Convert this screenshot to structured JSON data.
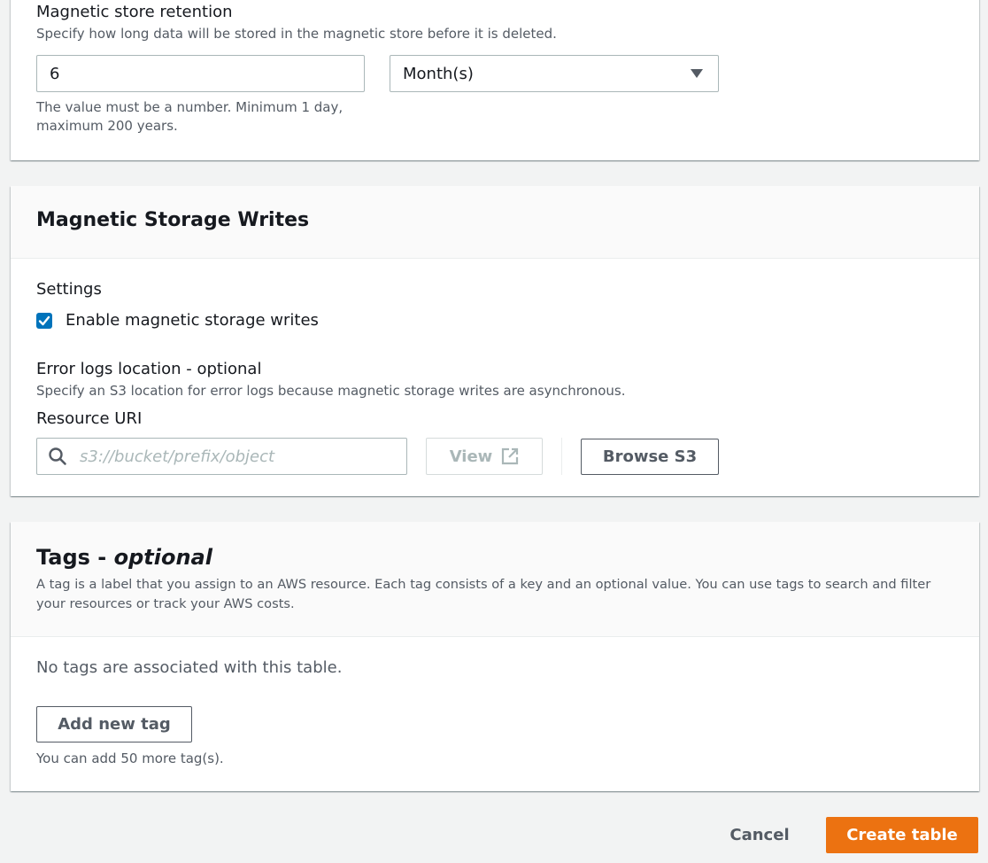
{
  "retention": {
    "label": "Magnetic store retention",
    "description": "Specify how long data will be stored in the magnetic store before it is deleted.",
    "value": "6",
    "unit_selected": "Month(s)",
    "hint_line1": "The value must be a number. Minimum 1 day,",
    "hint_line2": "maximum 200 years."
  },
  "writes": {
    "title": "Magnetic Storage Writes",
    "settings_label": "Settings",
    "checkbox_label": "Enable magnetic storage writes",
    "checkbox_checked": true,
    "error_logs_label": "Error logs location - optional",
    "error_logs_description": "Specify an S3 location for error logs because magnetic storage writes are asynchronous.",
    "resource_uri_label": "Resource URI",
    "resource_uri_placeholder": "s3://bucket/prefix/object",
    "view_label": "View",
    "browse_label": "Browse S3"
  },
  "tags": {
    "title": "Tags - ",
    "title_optional": "optional",
    "description_line1": "A tag is a label that you assign to an AWS resource. Each tag consists of a key and an optional value. You can use tags to search and filter",
    "description_line2": "your resources or track your AWS costs.",
    "empty_text": "No tags are associated with this table.",
    "add_label": "Add new tag",
    "limit_text": "You can add 50 more tag(s)."
  },
  "footer": {
    "cancel_label": "Cancel",
    "create_label": "Create table"
  },
  "colors": {
    "primary": "#ec7211",
    "checkbox": "#0073bb",
    "text": "#16191f",
    "muted": "#545b64"
  },
  "icons": {
    "search": "search-icon",
    "external": "external-link-icon",
    "caret": "caret-down-icon",
    "check": "check-icon"
  }
}
